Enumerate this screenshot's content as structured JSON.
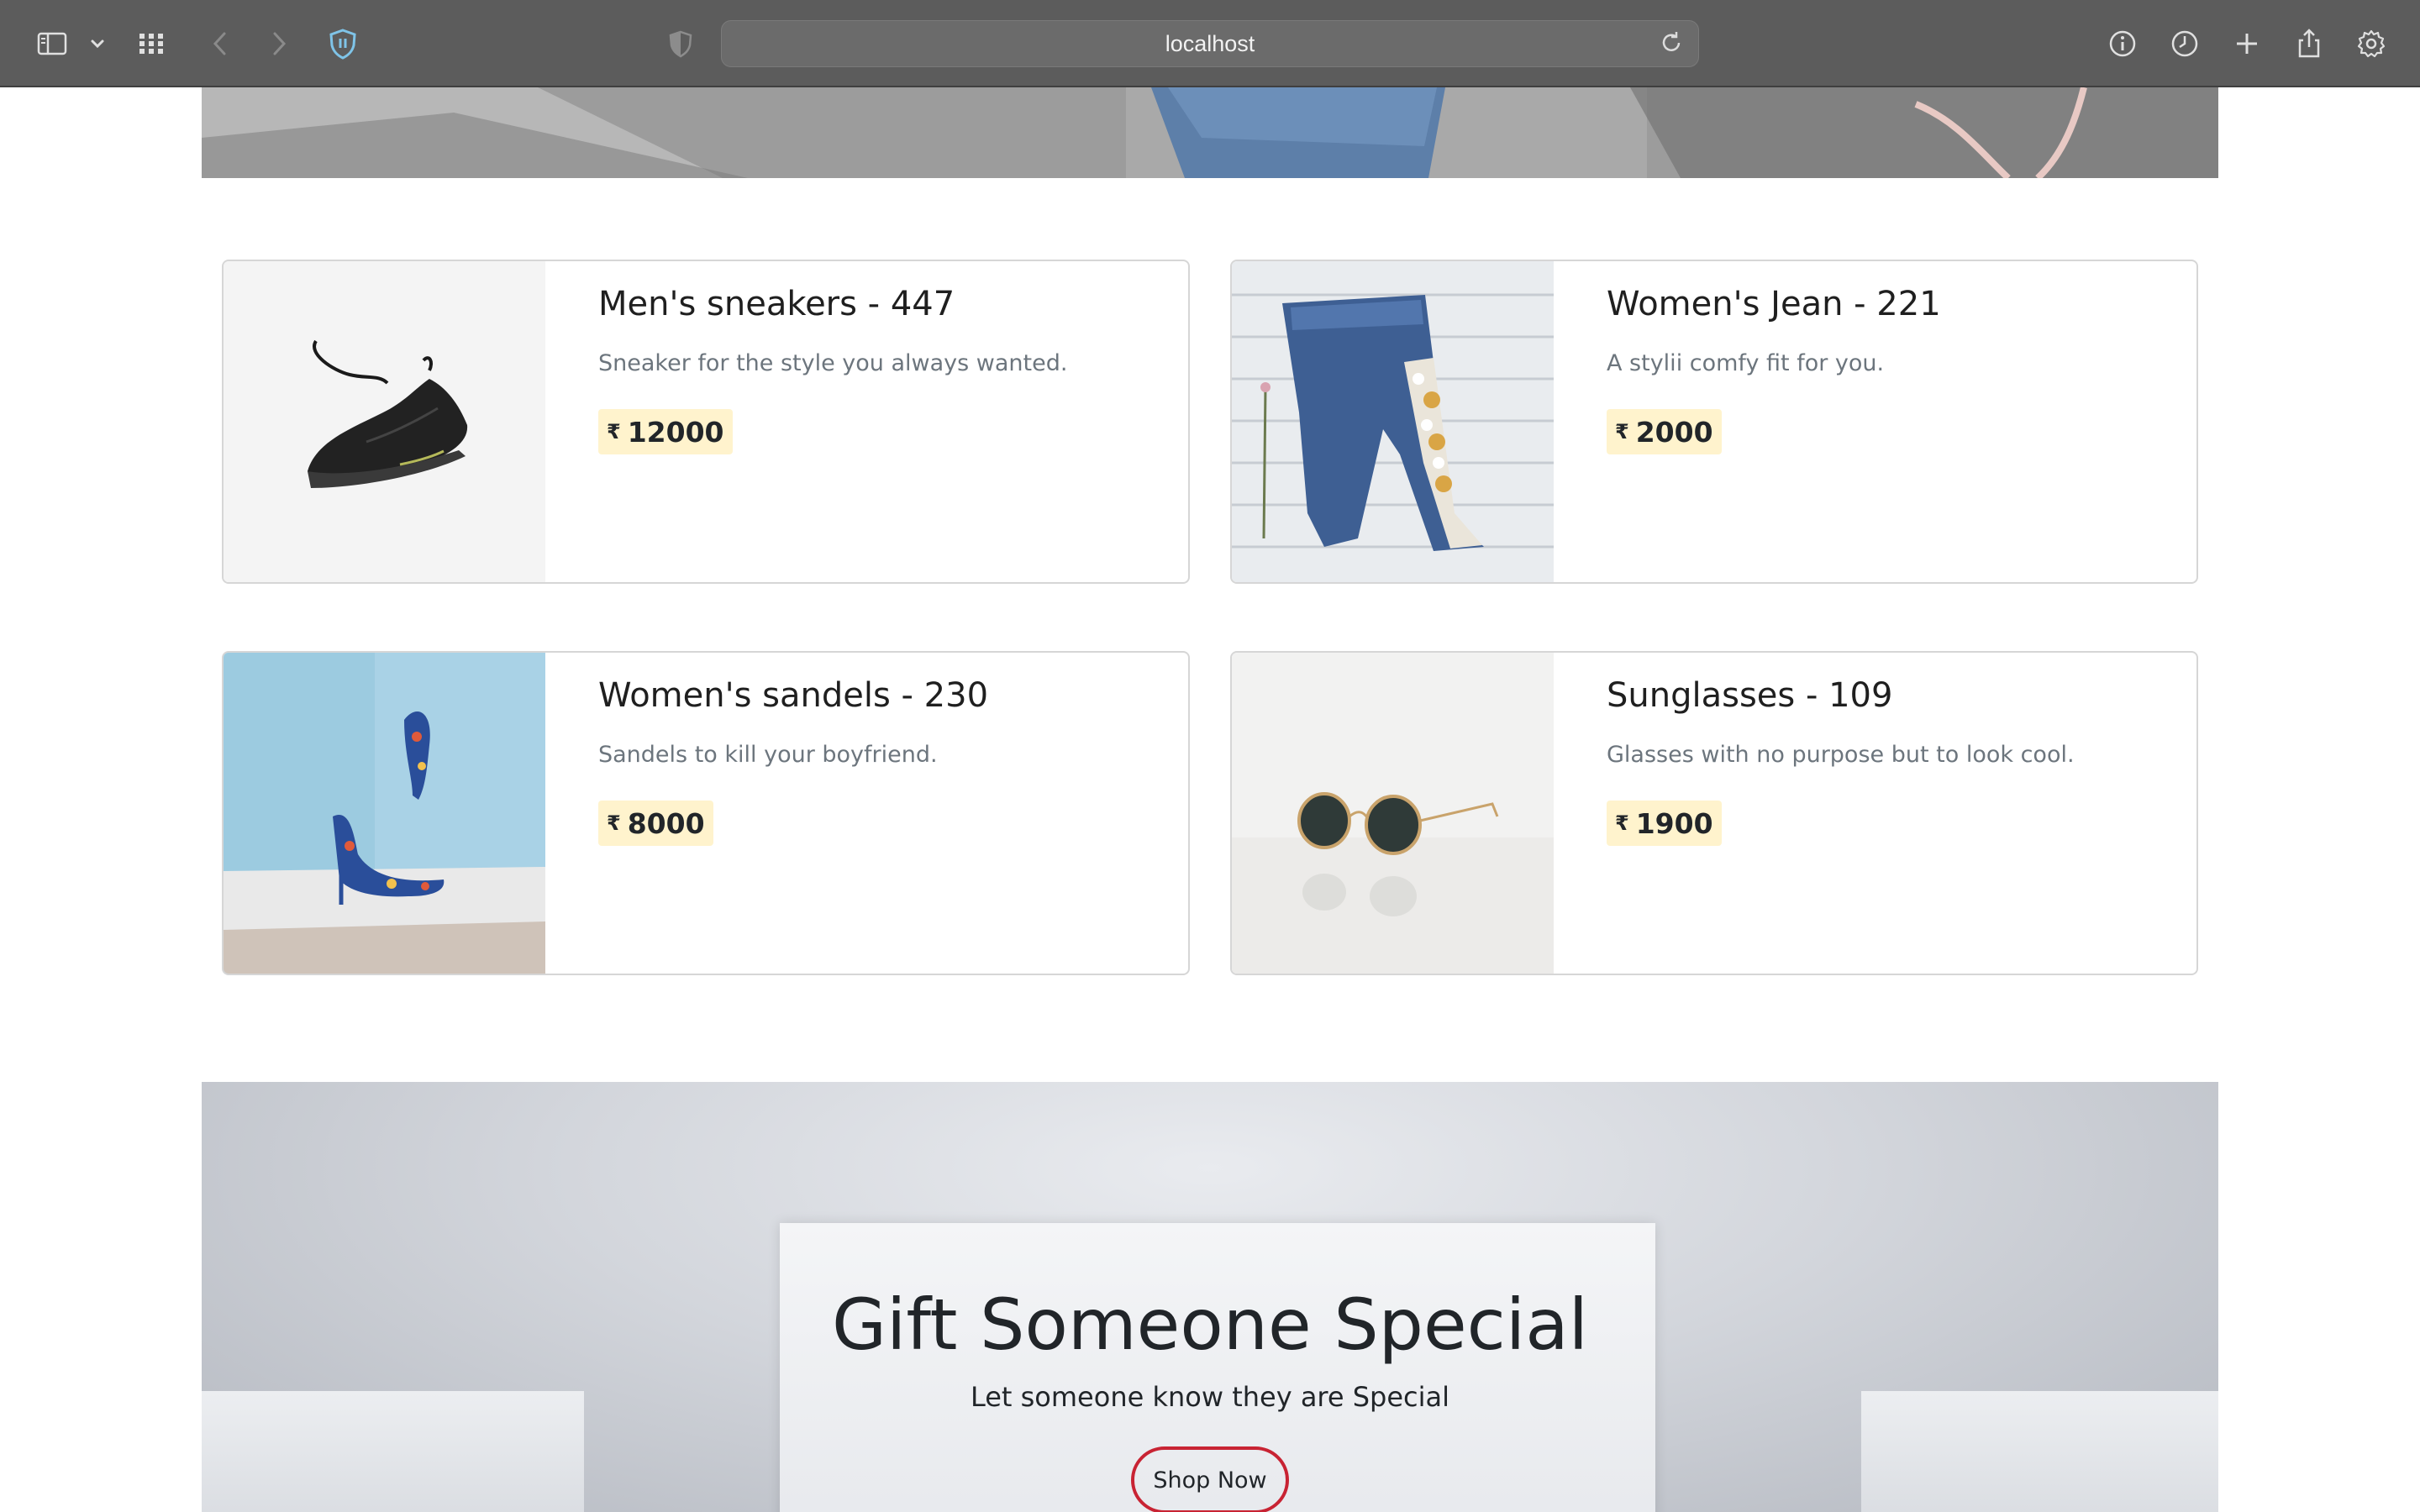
{
  "browser": {
    "url": "localhost",
    "icons": [
      "sidebar-icon",
      "chevron-down-icon",
      "grid-icon",
      "back-icon",
      "forward-icon",
      "shield-icon",
      "privacy-icon",
      "reload-icon",
      "info-icon",
      "history-icon",
      "plus-icon",
      "share-icon",
      "gear-icon"
    ]
  },
  "products": [
    {
      "title": "Men's sneakers - 447",
      "description": "Sneaker for the style you always wanted.",
      "currency": "₹",
      "price": "12000",
      "image": "sneaker-image"
    },
    {
      "title": "Women's Jean - 221",
      "description": "A stylii comfy fit for you.",
      "currency": "₹",
      "price": "2000",
      "image": "jeans-image"
    },
    {
      "title": "Women's sandels - 230",
      "description": "Sandels to kill your boyfriend.",
      "currency": "₹",
      "price": "8000",
      "image": "heels-image"
    },
    {
      "title": "Sunglasses - 109",
      "description": "Glasses with no purpose but to look cool.",
      "currency": "₹",
      "price": "1900",
      "image": "sunglasses-image"
    }
  ],
  "promo": {
    "heading": "Gift Someone Special",
    "subheading": "Let someone know they are Special",
    "button": "Shop Now",
    "accent": "#c82333"
  },
  "colors": {
    "price_badge": "#fff3cd",
    "toolbar": "#5c5c5c"
  }
}
